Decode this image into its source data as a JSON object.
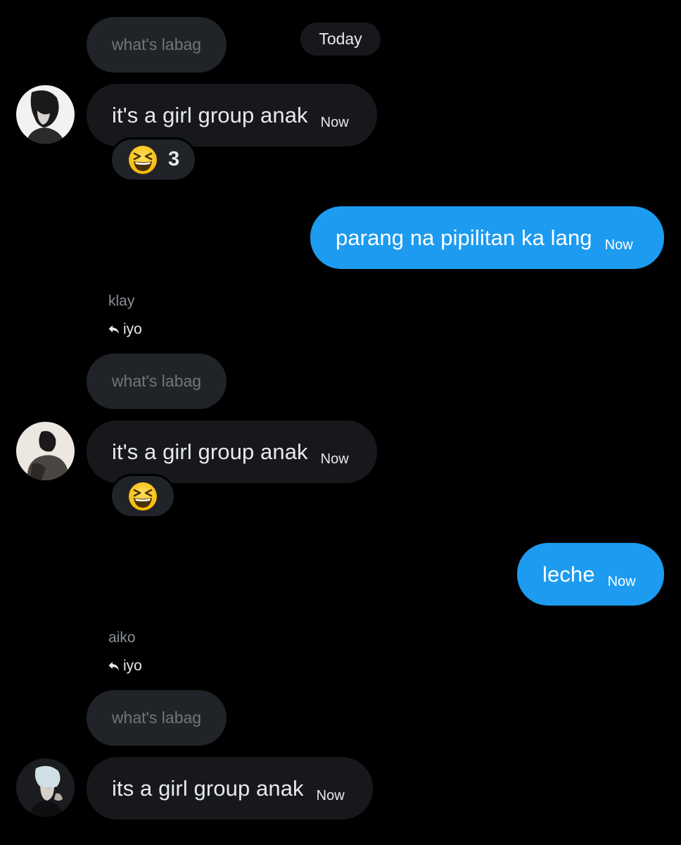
{
  "date_separator": "Today",
  "messages": [
    {
      "quoted_text": "what's labag",
      "text": "it's a girl group anak",
      "time": "Now",
      "reaction": {
        "emoji": "😆",
        "count": "3"
      }
    },
    {
      "text": "parang na pipilitan ka lang",
      "time": "Now"
    },
    {
      "sender": "klay",
      "reply_to": "iyo",
      "quoted_text": "what's labag",
      "text": "it's a girl group anak",
      "time": "Now",
      "reaction": {
        "emoji": "😆"
      }
    },
    {
      "text": "leche",
      "time": "Now"
    },
    {
      "sender": "aiko",
      "reply_to": "iyo",
      "quoted_text": "what's labag",
      "text": "its a girl group anak",
      "time": "Now"
    }
  ],
  "colors": {
    "background": "#000000",
    "incoming_bubble": "#16181c",
    "quoted_bubble": "#202327",
    "outgoing_bubble": "#1d9bf0",
    "muted_text": "#71767b"
  }
}
